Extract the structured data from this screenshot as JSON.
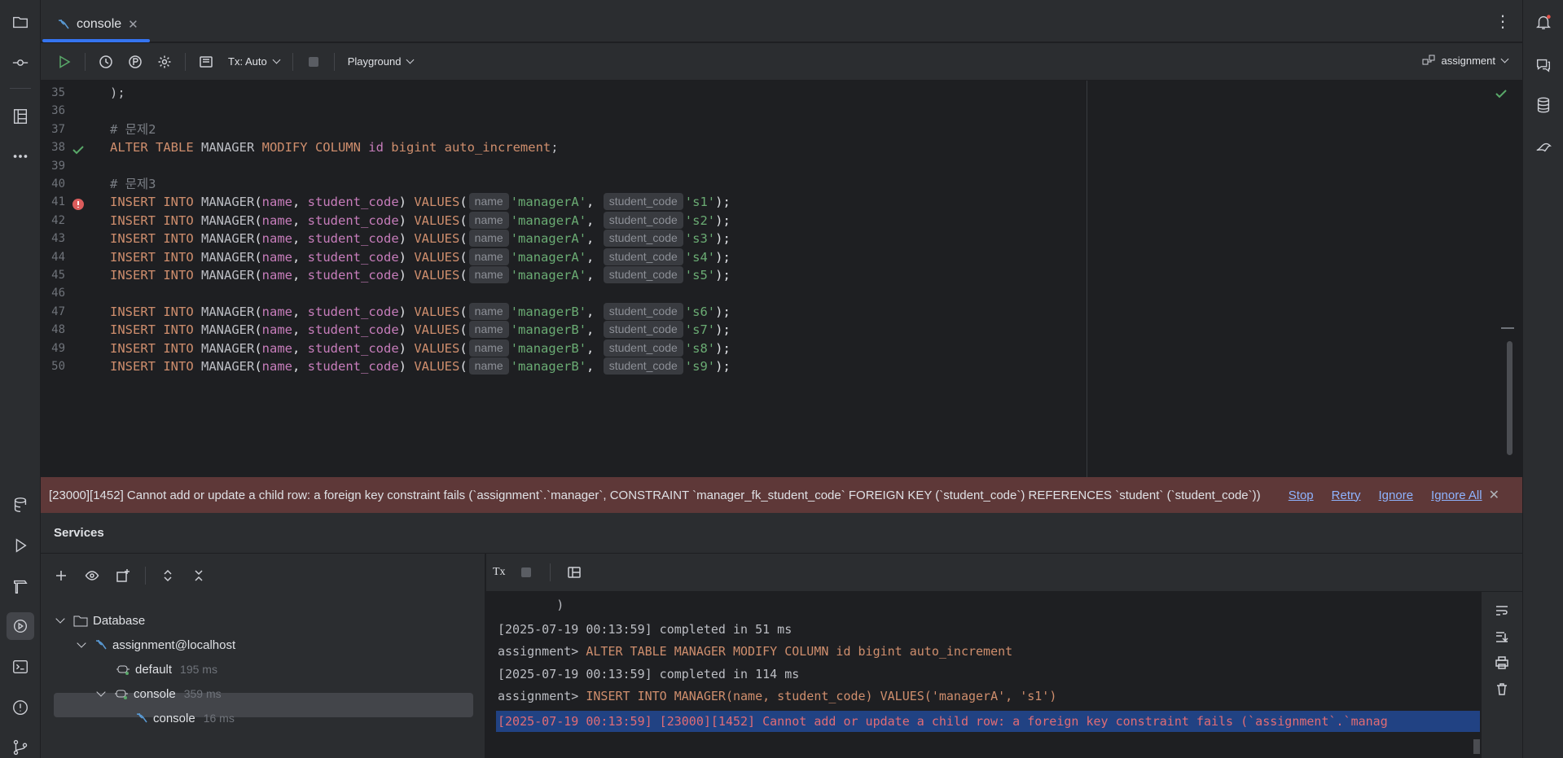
{
  "tab": {
    "label": "console"
  },
  "toolbar": {
    "tx_mode": "Tx: Auto",
    "playground": "Playground",
    "schema": "assignment"
  },
  "editor": {
    "lines": [
      {
        "n": "35",
        "code": ");"
      },
      {
        "n": "36",
        "code": ""
      },
      {
        "n": "37",
        "code": "# 문제2"
      },
      {
        "n": "38",
        "code": "ALTER TABLE MANAGER MODIFY COLUMN id bigint auto_increment;"
      },
      {
        "n": "39",
        "code": ""
      },
      {
        "n": "40",
        "code": "# 문제3"
      },
      {
        "n": "41",
        "name": "'managerA'",
        "code_val": "'s1'"
      },
      {
        "n": "42",
        "name": "'managerA'",
        "code_val": "'s2'"
      },
      {
        "n": "43",
        "name": "'managerA'",
        "code_val": "'s3'"
      },
      {
        "n": "44",
        "name": "'managerA'",
        "code_val": "'s4'"
      },
      {
        "n": "45",
        "name": "'managerA'",
        "code_val": "'s5'"
      },
      {
        "n": "46",
        "code": ""
      },
      {
        "n": "47",
        "name": "'managerB'",
        "code_val": "'s6'"
      },
      {
        "n": "48",
        "name": "'managerB'",
        "code_val": "'s7'"
      },
      {
        "n": "49",
        "name": "'managerB'",
        "code_val": "'s8'"
      },
      {
        "n": "50",
        "name": "'managerB'",
        "code_val": "'s9'"
      }
    ],
    "insert_prefix": "INSERT INTO",
    "table": "MANAGER",
    "col_name": "name",
    "col_code": "student_code",
    "values_kw": "VALUES",
    "hint_name": "name",
    "hint_code": "student_code"
  },
  "error_bar": {
    "message": "[23000][1452] Cannot add or update a child row: a foreign key constraint fails (`assignment`.`manager`, CONSTRAINT `manager_fk_student_code` FOREIGN KEY (`student_code`) REFERENCES `student` (`student_code`))",
    "stop": "Stop",
    "retry": "Retry",
    "ignore": "Ignore",
    "ignore_all": "Ignore All"
  },
  "services": {
    "title": "Services",
    "tree": {
      "database": "Database",
      "connection": "assignment@localhost",
      "default_session": "default",
      "default_time": "195 ms",
      "console_session": "console",
      "console_time": "359 ms",
      "console_leaf": "console",
      "console_leaf_time": "16 ms"
    },
    "output": {
      "line0": "        )",
      "line1": "[2025-07-19 00:13:59] completed in 51 ms",
      "line2_prompt": "assignment> ",
      "line2_sql": "ALTER TABLE MANAGER MODIFY COLUMN id bigint auto_increment",
      "line3": "[2025-07-19 00:13:59] completed in 114 ms",
      "line4_prompt": "assignment> ",
      "line4_sql": "INSERT INTO MANAGER(name, student_code) VALUES('managerA', 's1')",
      "error": "[2025-07-19 00:13:59] [23000][1452] Cannot add or update a child row: a foreign key constraint fails (`assignment`.`manag"
    },
    "tx_label": "Tx"
  }
}
